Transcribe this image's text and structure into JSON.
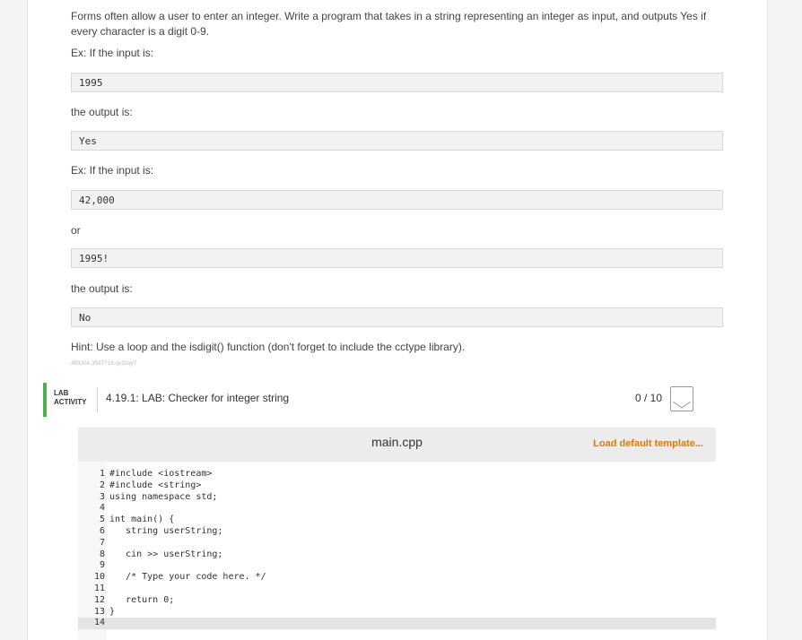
{
  "problem": {
    "intro": "Forms often allow a user to enter an integer. Write a program that takes in a string representing an integer as input, and outputs Yes if every character is a digit 0-9.",
    "ex1_label": "Ex: If the input is:",
    "ex1_input": "1995",
    "ex1_output_label": "the output is:",
    "ex1_output": "Yes",
    "ex2_label": "Ex: If the input is:",
    "ex2_input_a": "42,000",
    "or_label": "or",
    "ex2_input_b": "1995!",
    "ex2_output_label": "the output is:",
    "ex2_output": "No",
    "hint": "Hint: Use a loop and the isdigit() function (don't forget to include the cctype library).",
    "tracking_id": "489204.3587718.qx3zqy7"
  },
  "lab": {
    "tag_line1": "LAB",
    "tag_line2": "ACTIVITY",
    "title": "4.19.1: LAB: Checker for integer string",
    "score": "0 / 10"
  },
  "editor": {
    "file_name": "main.cpp",
    "load_label": "Load default template...",
    "lines": [
      {
        "n": "1",
        "text": "#include <iostream>"
      },
      {
        "n": "2",
        "text": "#include <string>"
      },
      {
        "n": "3",
        "text": "using namespace std;"
      },
      {
        "n": "4",
        "text": ""
      },
      {
        "n": "5",
        "text": "int main() {"
      },
      {
        "n": "6",
        "text": "   string userString;"
      },
      {
        "n": "7",
        "text": ""
      },
      {
        "n": "8",
        "text": "   cin >> userString;"
      },
      {
        "n": "9",
        "text": ""
      },
      {
        "n": "10",
        "text": "   /* Type your code here. */"
      },
      {
        "n": "11",
        "text": ""
      },
      {
        "n": "12",
        "text": "   return 0;"
      },
      {
        "n": "13",
        "text": "}"
      },
      {
        "n": "14",
        "text": ""
      }
    ]
  },
  "colors": {
    "accent_green": "#4caf50",
    "load_orange": "#e07b00"
  }
}
